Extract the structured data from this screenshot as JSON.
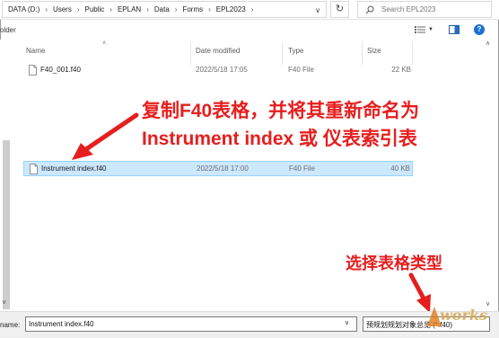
{
  "address_bar": {
    "breadcrumbs": [
      "DATA (D:)",
      "Users",
      "Public",
      "EPLAN",
      "Data",
      "Forms",
      "EPL2023"
    ]
  },
  "search": {
    "placeholder": "Search EPL2023"
  },
  "toolbar": {
    "folder_fragment": "older"
  },
  "columns": {
    "name": "Name",
    "date": "Date modified",
    "type": "Type",
    "size": "Size"
  },
  "files": [
    {
      "name": "F40_001.f40",
      "date": "2022/5/18 17:05",
      "type": "F40 File",
      "size": "22 KB",
      "selected": false
    },
    {
      "name": "Instrument index.f40",
      "date": "2022/5/18 17:00",
      "type": "F40 File",
      "size": "40 KB",
      "selected": true
    }
  ],
  "annotations": {
    "line1": "复制F40表格，并将其重新命名为",
    "line2": "Instrument index 或 仪表索引表",
    "line3": "选择表格类型"
  },
  "footer": {
    "filename_label": "name:",
    "filename_value": "Instrument index.f40",
    "filetype_value": "预规划规划对象总览 (*.f40)"
  },
  "watermark": {
    "logo_text": "works"
  },
  "colors": {
    "annotation_red": "#e61e1e",
    "selection_bg": "#cce8ff",
    "selection_border": "#99d1ff"
  },
  "icons": {
    "addr_dropdown": "chevron-down-icon",
    "refresh": "refresh-icon",
    "search": "search-icon",
    "view_menu": "view-options-icon",
    "preview": "preview-pane-icon",
    "help": "help-icon",
    "file": "file-icon"
  }
}
